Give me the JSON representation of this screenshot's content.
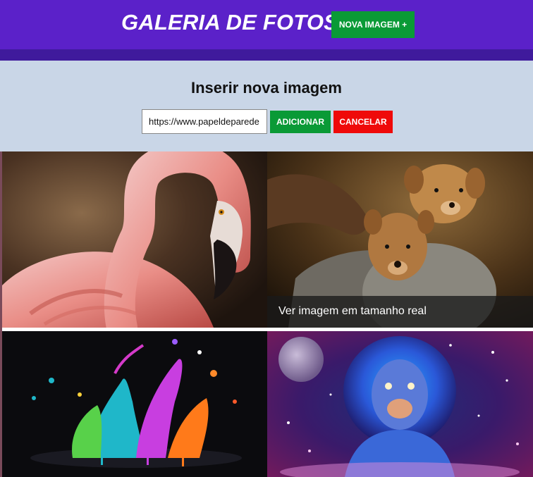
{
  "header": {
    "title": "GALERIA DE FOTOS",
    "new_image_button": "NOVA IMAGEM +"
  },
  "insert_form": {
    "title": "Inserir nova imagem",
    "url_value": "https://www.papeldeparede",
    "add_button": "ADICIONAR",
    "cancel_button": "CANCELAR"
  },
  "gallery": {
    "overlay_text": "Ver imagem em tamanho real",
    "images": [
      {
        "subject": "flamingo"
      },
      {
        "subject": "puppies"
      },
      {
        "subject": "paint-splash"
      },
      {
        "subject": "cosmic-lion"
      }
    ]
  },
  "colors": {
    "header": "#5b21c9",
    "header_strip": "#3f1a9c",
    "panel": "#c9d6e7",
    "green": "#0a9a36",
    "red": "#ef0a0a"
  }
}
